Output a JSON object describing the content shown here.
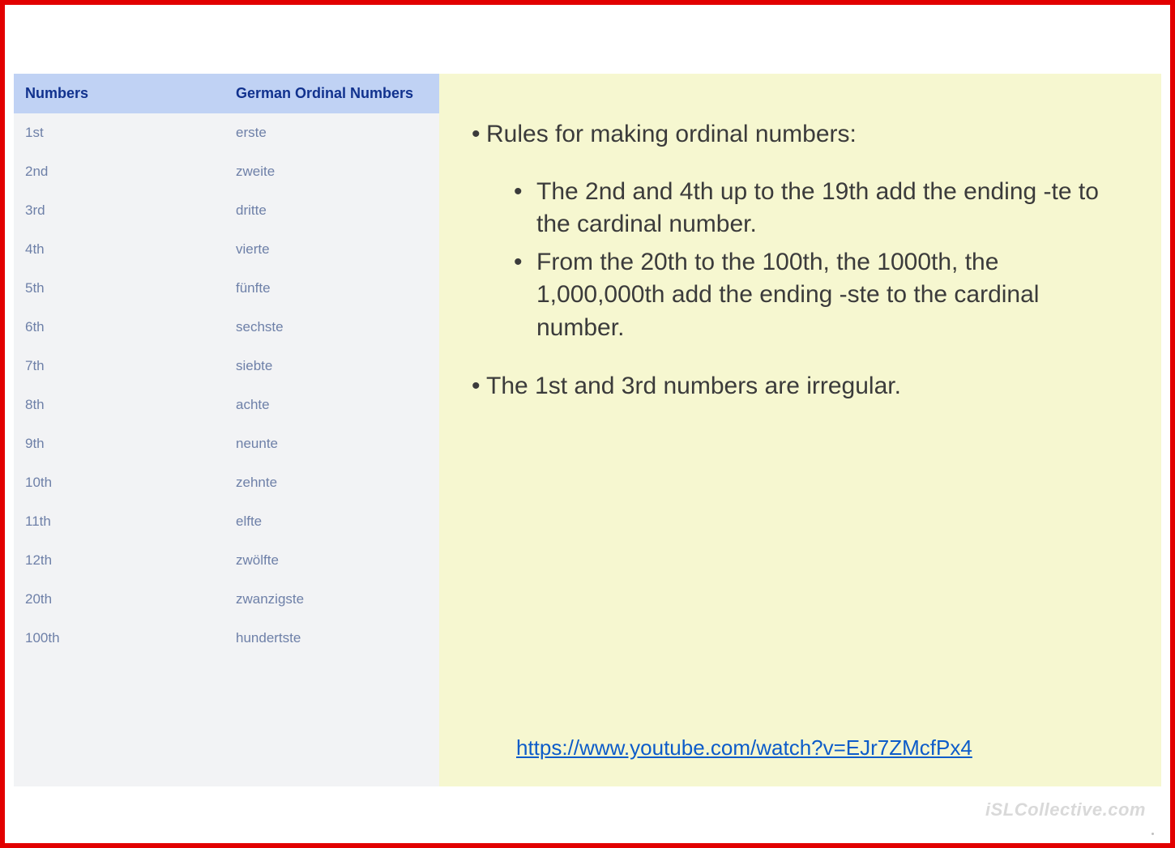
{
  "table": {
    "headers": {
      "col1": "Numbers",
      "col2": "German Ordinal Numbers"
    },
    "rows": [
      {
        "col1": "1st",
        "col2": "erste"
      },
      {
        "col1": "2nd",
        "col2": "zweite"
      },
      {
        "col1": "3rd",
        "col2": "dritte"
      },
      {
        "col1": "4th",
        "col2": "vierte"
      },
      {
        "col1": "5th",
        "col2": "fünfte"
      },
      {
        "col1": "6th",
        "col2": "sechste"
      },
      {
        "col1": "7th",
        "col2": "siebte"
      },
      {
        "col1": "8th",
        "col2": "achte"
      },
      {
        "col1": "9th",
        "col2": "neunte"
      },
      {
        "col1": "10th",
        "col2": "zehnte"
      },
      {
        "col1": "11th",
        "col2": "elfte"
      },
      {
        "col1": "12th",
        "col2": "zwölfte"
      },
      {
        "col1": "20th",
        "col2": "zwanzigste"
      },
      {
        "col1": "100th",
        "col2": "hundertste"
      }
    ]
  },
  "content": {
    "heading": "Rules for making ordinal numbers:",
    "sub": [
      "The 2nd and 4th up to the 19th add the ending -te to the cardinal number.",
      "From the 20th to the 100th, the 1000th, the 1,000,000th add the ending -ste to the cardinal number."
    ],
    "second": "The 1st and 3rd numbers are irregular.",
    "link_text": "https://www.youtube.com/watch?v=EJr7ZMcfPx4",
    "link_href": "https://www.youtube.com/watch?v=EJr7ZMcfPx4"
  },
  "watermark": "iSLCollective.com"
}
